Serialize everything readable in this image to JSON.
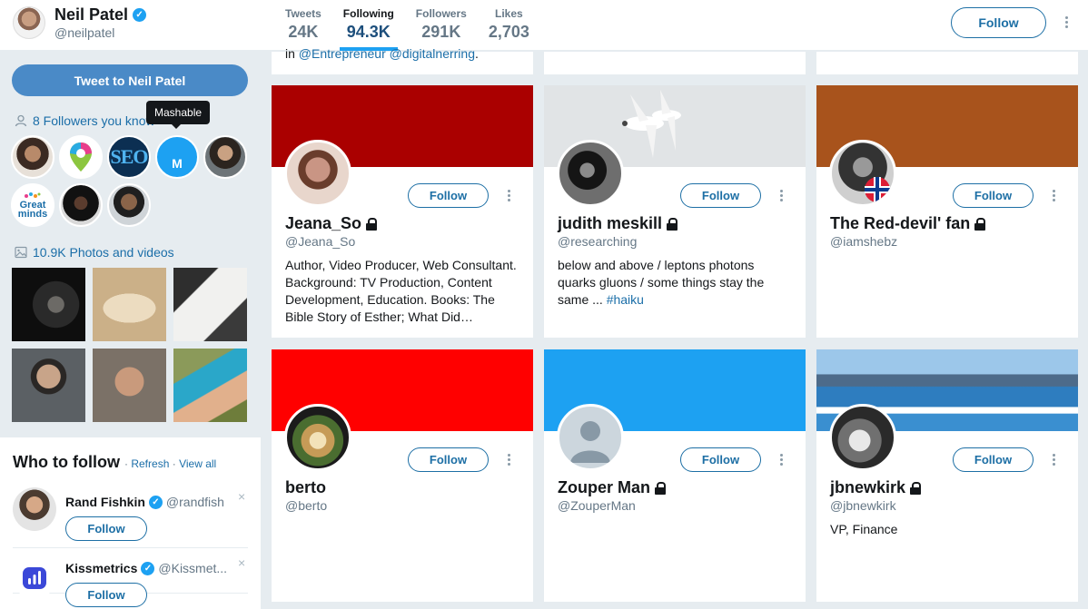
{
  "profile": {
    "name": "Neil Patel",
    "handle": "@neilpatel",
    "verified": true
  },
  "stats": [
    {
      "label": "Tweets",
      "value": "24K",
      "active": false
    },
    {
      "label": "Following",
      "value": "94.3K",
      "active": true
    },
    {
      "label": "Followers",
      "value": "291K",
      "active": false
    },
    {
      "label": "Likes",
      "value": "2,703",
      "active": false
    }
  ],
  "header_follow": "Follow",
  "sidebar": {
    "tweet_to": "Tweet to Neil Patel",
    "followers_you_know": "8 Followers you know",
    "tooltip": "Mashable",
    "seo_label": "SEO",
    "mashable_letter": "M",
    "great_minds_line1": "Great",
    "great_minds_line2": "minds",
    "photos_videos": "10.9K Photos and videos"
  },
  "who_to_follow": {
    "title": "Who to follow",
    "refresh": "Refresh",
    "separator": "·",
    "view_all": "View all",
    "items": [
      {
        "name": "Rand Fishkin",
        "handle": "@randfish",
        "verified": true,
        "button": "Follow",
        "dismiss": "×"
      },
      {
        "name": "Kissmetrics",
        "handle": "@Kissmet...",
        "verified": true,
        "button": "Follow",
        "dismiss": "×"
      }
    ]
  },
  "top_partial": {
    "prefix": "in ",
    "links": "@Entrepreneur @digitalnerring",
    "suffix": "."
  },
  "cards": [
    {
      "name": "Jeana_So",
      "handle": "@Jeana_So",
      "protected": true,
      "button": "Follow",
      "bio": "Author, Video Producer, Web Consultant. Background: TV Production, Content Development, Education. Books: The Bible Story of Esther; What Did…",
      "bio_tag": "",
      "banner_color": "#aa0000"
    },
    {
      "name": "judith meskill",
      "handle": "@researching",
      "protected": true,
      "button": "Follow",
      "bio": "below and above / leptons photons quarks gluons / some things stay the same ... ",
      "bio_tag": "#haiku",
      "banner_color": "#e1e4e6"
    },
    {
      "name": "The Red-devil' fan",
      "handle": "@iamshebz",
      "protected": true,
      "button": "Follow",
      "bio": "",
      "bio_tag": "",
      "banner_color": "#a8531c"
    },
    {
      "name": "berto",
      "handle": "@berto",
      "protected": false,
      "button": "Follow",
      "bio": "",
      "bio_tag": "",
      "banner_color": "#ff0000"
    },
    {
      "name": "Zouper Man",
      "handle": "@ZouperMan",
      "protected": true,
      "button": "Follow",
      "bio": "",
      "bio_tag": "",
      "banner_color": "#1da1f2"
    },
    {
      "name": "jbnewkirk",
      "handle": "@jbnewkirk",
      "protected": true,
      "button": "Follow",
      "bio": "VP, Finance",
      "bio_tag": "",
      "banner_color": "#4d8fc4"
    }
  ]
}
